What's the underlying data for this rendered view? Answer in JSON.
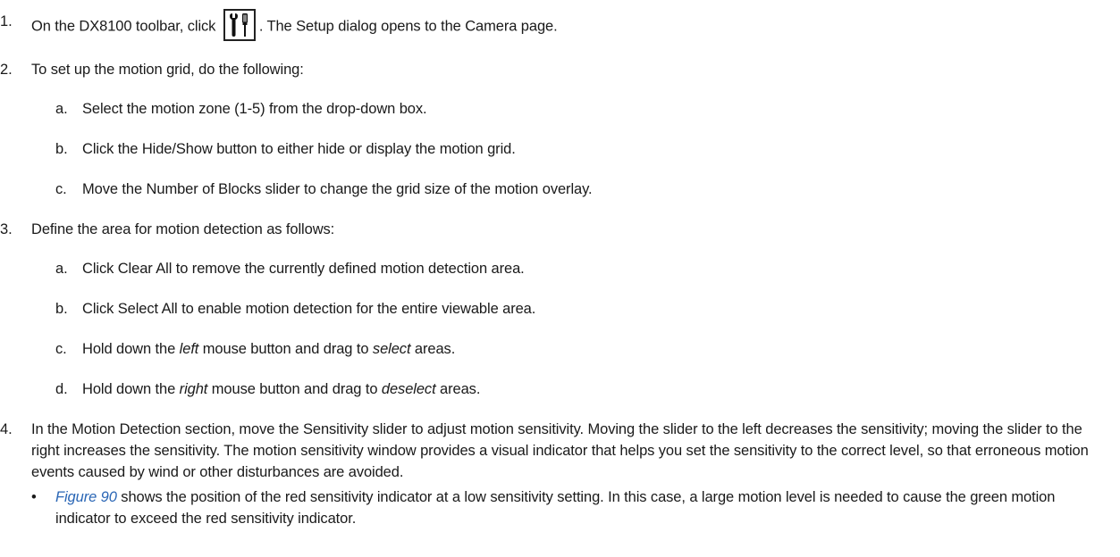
{
  "step1": {
    "num": "1.",
    "text_before": "On the DX8100 toolbar, click",
    "text_after": ". The Setup dialog opens to the Camera page.",
    "icon": "setup-tools-icon"
  },
  "step2": {
    "num": "2.",
    "text": "To set up the motion grid, do the following:",
    "items": [
      {
        "letter": "a.",
        "text": "Select the motion zone (1-5) from the drop-down box."
      },
      {
        "letter": "b.",
        "text": "Click the Hide/Show button to either hide or display the motion grid."
      },
      {
        "letter": "c.",
        "text": "Move the Number of Blocks slider to change the grid size of the motion overlay."
      }
    ]
  },
  "step3": {
    "num": "3.",
    "text": "Define the area for motion detection as follows:",
    "items": [
      {
        "letter": "a.",
        "text": "Click Clear All to remove the currently defined motion detection area."
      },
      {
        "letter": "b.",
        "text": "Click Select All to enable motion detection for the entire viewable area."
      },
      {
        "letter": "c.",
        "pre": "Hold down the ",
        "em1": "left",
        "mid": " mouse button and drag to ",
        "em2": "select",
        "post": " areas."
      },
      {
        "letter": "d.",
        "pre": "Hold down the ",
        "em1": "right",
        "mid": " mouse button and drag to ",
        "em2": "deselect",
        "post": " areas."
      }
    ]
  },
  "step4": {
    "num": "4.",
    "text": "In the Motion Detection section, move the Sensitivity slider to adjust motion sensitivity. Moving the slider to the left decreases the sensitivity; moving the slider to the right increases the sensitivity. The motion sensitivity window provides a visual indicator that helps you set the sensitivity to the correct level, so that erroneous motion events caused by wind or other disturbances are avoided.",
    "bullet": {
      "dot": "•",
      "link": "Figure 90",
      "text": " shows the position of the red sensitivity indicator at a low sensitivity setting. In this case, a large motion level is needed to cause the green motion indicator to exceed the red sensitivity indicator."
    }
  }
}
